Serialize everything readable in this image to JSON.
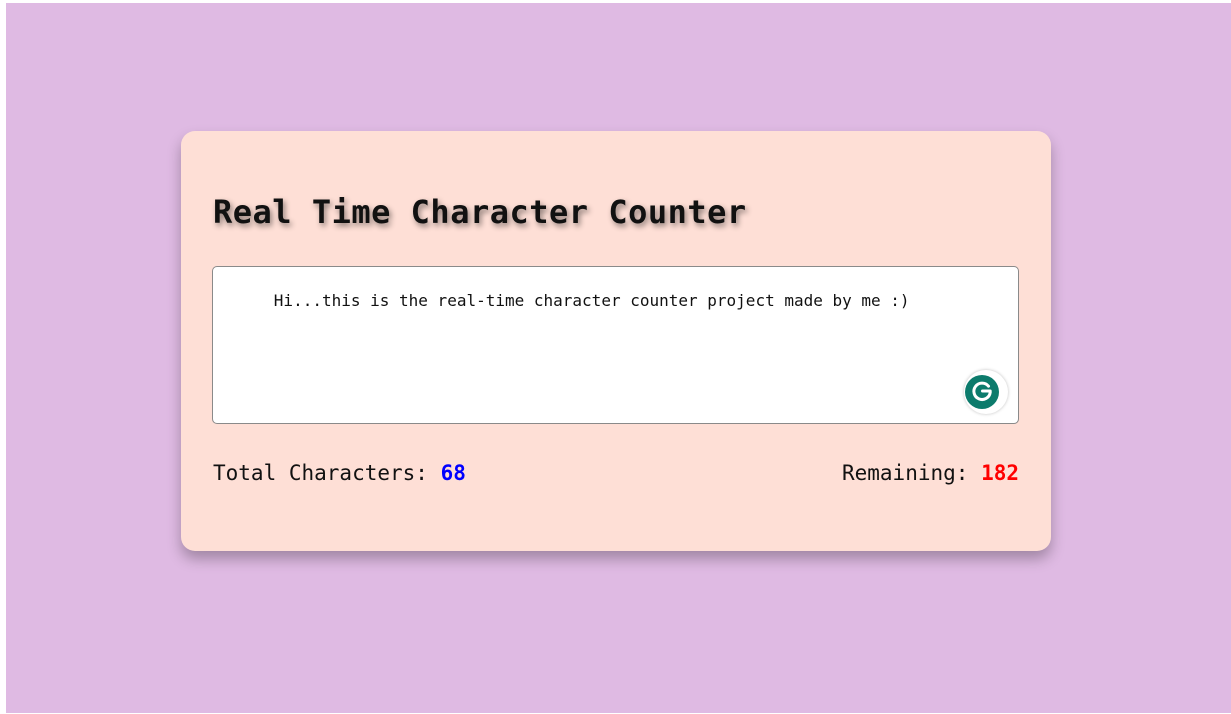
{
  "page": {
    "background_color": "#dfbae3"
  },
  "card": {
    "background_color": "#fedfd6",
    "title": "Real Time Character Counter",
    "textarea": {
      "value": "Hi...this is the real-time character counter project made by me :)"
    },
    "grammarly_icon": "grammarly-g-icon",
    "stats": {
      "total_label": "Total Characters: ",
      "total_value": "68",
      "total_color": "#0000ff",
      "remaining_label": "Remaining: ",
      "remaining_value": "182",
      "remaining_color": "#ff0000"
    }
  }
}
